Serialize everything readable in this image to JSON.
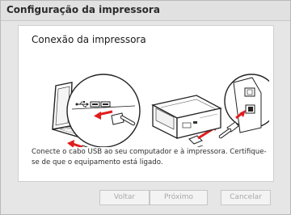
{
  "window": {
    "title": "Configuração da impressora"
  },
  "panel": {
    "heading": "Conexão da impressora",
    "description": "Conecte o cabo USB ao seu computador e à impressora. Certifique-se de que o equipamento está ligado.",
    "illustration": {
      "icons": [
        "laptop-icon",
        "usb-symbol-icon",
        "usb-port-icon",
        "printer-icon",
        "usb-cable-icon"
      ],
      "arrow_color": "#e11d1d"
    }
  },
  "buttons": {
    "back_label": "Voltar",
    "next_label": "Próximo",
    "cancel_label": "Cancelar"
  }
}
